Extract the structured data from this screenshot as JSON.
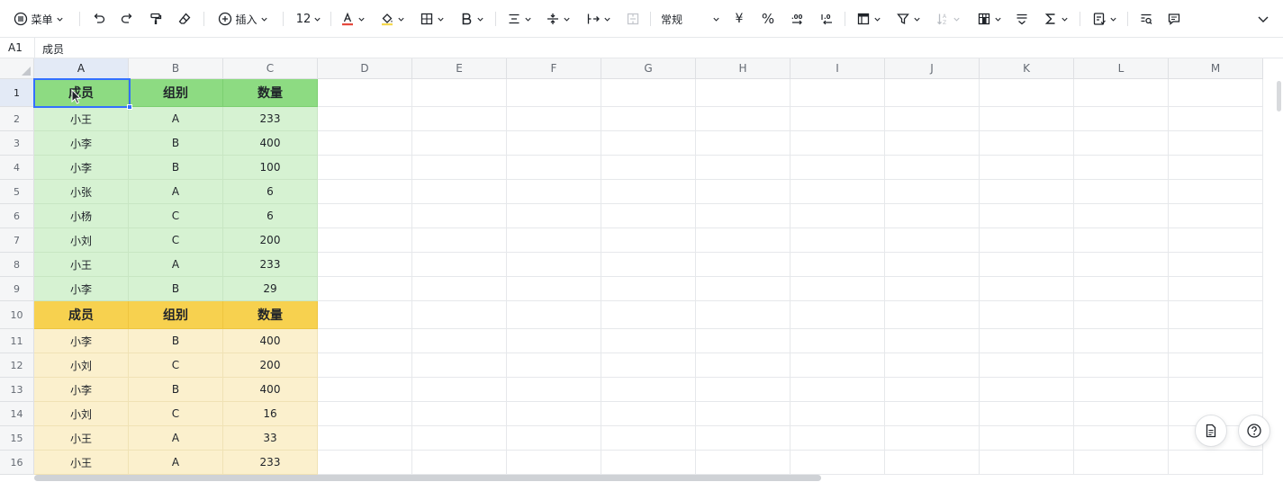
{
  "toolbar": {
    "menu_label": "菜单",
    "insert_label": "插入",
    "font_size": "12",
    "number_format": "常规",
    "currency_symbol": "¥",
    "percent_symbol": "%",
    "text_color": "#e5483d",
    "fill_color": "#f5d84e"
  },
  "formula_bar": {
    "cell_ref": "A1",
    "content": "成员"
  },
  "columns": [
    "A",
    "B",
    "C",
    "D",
    "E",
    "F",
    "G",
    "H",
    "I",
    "J",
    "K",
    "L",
    "M"
  ],
  "rows": [
    "1",
    "2",
    "3",
    "4",
    "5",
    "6",
    "7",
    "8",
    "9",
    "10",
    "11",
    "12",
    "13",
    "14",
    "15",
    "16"
  ],
  "table1": {
    "header": [
      "成员",
      "组别",
      "数量"
    ],
    "rows": [
      [
        "小王",
        "A",
        "233"
      ],
      [
        "小李",
        "B",
        "400"
      ],
      [
        "小李",
        "B",
        "100"
      ],
      [
        "小张",
        "A",
        "6"
      ],
      [
        "小杨",
        "C",
        "6"
      ],
      [
        "小刘",
        "C",
        "200"
      ],
      [
        "小王",
        "A",
        "233"
      ],
      [
        "小李",
        "B",
        "29"
      ]
    ]
  },
  "table2": {
    "header": [
      "成员",
      "组别",
      "数量"
    ],
    "rows": [
      [
        "小李",
        "B",
        "400"
      ],
      [
        "小刘",
        "C",
        "200"
      ],
      [
        "小李",
        "B",
        "400"
      ],
      [
        "小刘",
        "C",
        "16"
      ],
      [
        "小王",
        "A",
        "33"
      ],
      [
        "小王",
        "A",
        "233"
      ]
    ]
  },
  "colors": {
    "green_header": "#8ddb82",
    "green_body": "#d6f2d2",
    "yellow_header": "#f7d14f",
    "yellow_body": "#fbf0cd",
    "selection": "#3370ff"
  },
  "icons": {
    "menu": "list-circle-icon",
    "undo": "undo-icon",
    "redo": "redo-icon",
    "format_painter": "format-painter-icon",
    "clear_format": "eraser-icon",
    "insert": "plus-circle-icon",
    "text_color": "font-color-icon",
    "fill_color": "paint-bucket-icon",
    "borders": "border-icon",
    "bold": "bold-icon",
    "h_align": "align-center-icon",
    "v_align": "vertical-align-icon",
    "wrap": "wrap-text-icon",
    "merge": "merge-cells-icon",
    "dec_decimal": "decrease-decimal-icon",
    "inc_decimal": "increase-decimal-icon",
    "freeze": "freeze-icon",
    "filter": "filter-icon",
    "sort": "sort-icon",
    "cond_format": "conditional-format-icon",
    "strikethrough": "strikethrough-icon",
    "sum": "sum-icon",
    "data_tools": "data-tools-icon",
    "find": "find-icon",
    "comment": "comment-icon",
    "collapse": "chevron-down-icon",
    "doc": "document-icon",
    "help": "help-icon"
  }
}
